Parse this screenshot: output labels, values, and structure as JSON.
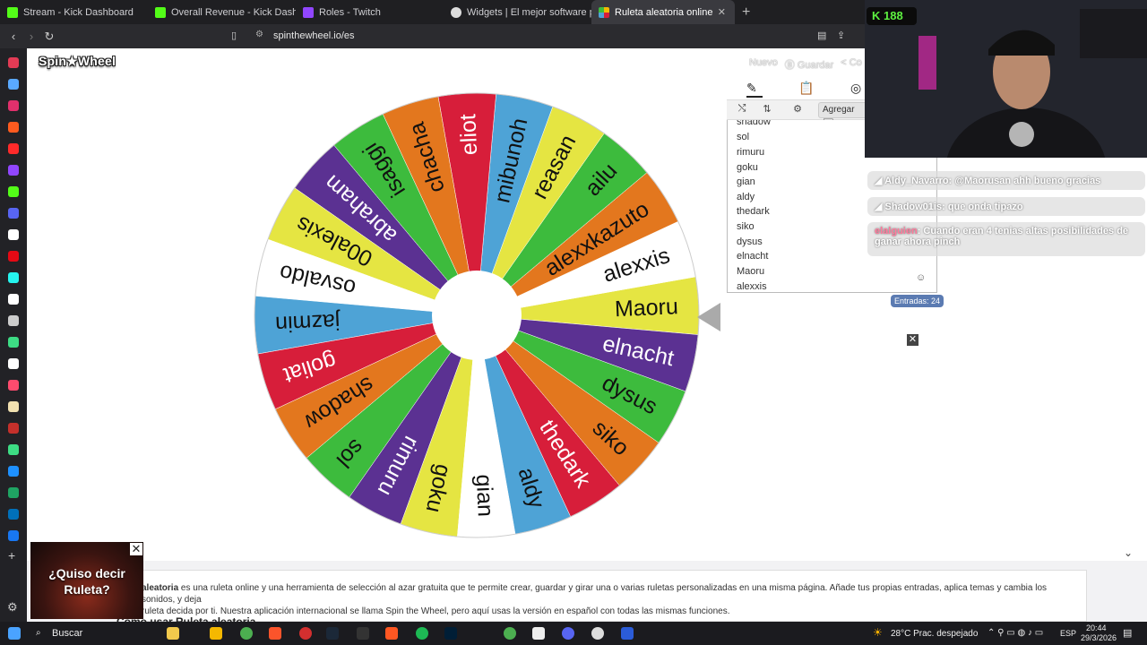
{
  "browser": {
    "tabs": [
      {
        "label": "Stream - Kick Dashboard",
        "color": "#53fc18"
      },
      {
        "label": "Overall Revenue - Kick Dashboard",
        "color": "#53fc18"
      },
      {
        "label": "Roles - Twitch",
        "color": "#9146ff"
      },
      {
        "label": "Widgets | El mejor software para pot",
        "color": "#dddddd"
      },
      {
        "label": "Ruleta aleatoria online – ruleta d",
        "color": "#f5b800"
      }
    ],
    "url": "spinthewheel.io/es"
  },
  "site": {
    "logo": "Spin★Wheel",
    "links": [
      "Nuevo",
      "Ⓑ Guardar",
      "< Co"
    ]
  },
  "wheel": {
    "names": [
      "Maoru",
      "alexxis",
      "alexxkazuto",
      "ailu",
      "reasan",
      "mibunoh",
      "eliot",
      "chacha",
      "isaggi",
      "abraham",
      "00alexis",
      "osvaldo",
      "jazmin",
      "goliat",
      "shadow",
      "sol",
      "rimuru",
      "goku",
      "gian",
      "aldy",
      "thedark",
      "siko",
      "dysus",
      "elnacht"
    ],
    "colors": [
      "#e5e542",
      "#ffffff",
      "#e3771e",
      "#3dbb3d",
      "#e5e542",
      "#4ea3d6",
      "#d71e3a",
      "#e3771e",
      "#3dbb3d",
      "#5b3192",
      "#e5e542",
      "#ffffff",
      "#4ea3d6",
      "#d71e3a",
      "#e3771e",
      "#3dbb3d",
      "#5b3192",
      "#e5e542",
      "#ffffff",
      "#4ea3d6",
      "#d71e3a",
      "#e3771e",
      "#3dbb3d",
      "#5b3192"
    ]
  },
  "panel": {
    "tabs": [
      "pencil-icon",
      "clipboard-icon",
      "eye-off-icon"
    ],
    "tools": [
      "shuffle-icon",
      "sort-icon",
      "settings-icon"
    ],
    "add_label": "Agregar 🖼",
    "entries": [
      "shadow",
      "sol",
      "rimuru",
      "goku",
      "gian",
      "aldy",
      "thedark",
      "siko",
      "dysus",
      "elnacht",
      "Maoru",
      "alexxis"
    ],
    "count": "Entradas: 24"
  },
  "stream": {
    "kick_count": "188",
    "chat": [
      {
        "user": "Aldy_Navarro",
        "text": ": @Maorusan ahh bueno gracias"
      },
      {
        "user": "Shadow01is",
        "text": ": que onda tipazo"
      },
      {
        "user": "elalguien",
        "text": ": Cuando eran 4 tenias altas posibilidades de ganar ahora pinch"
      }
    ]
  },
  "bottom": {
    "text_bold": "aleatoria",
    "text1": " es una ruleta online y una herramienta de selección al azar gratuita que te permite crear, guardar y girar una o varias ruletas personalizadas en una misma página. Añade tus propias entradas, aplica temas y cambia los sonidos, y deja",
    "text2": "ruleta decida por ti. Nuestra aplicación internacional se llama Spin the Wheel, pero aquí usas la versión en español con todas las mismas funciones.",
    "heading": "Cómo usar Ruleta aleatoria"
  },
  "ad": {
    "text": "¿Quiso decir Ruleta?"
  },
  "taskbar": {
    "search": "Buscar",
    "weather": "28°C  Prac. despejado",
    "lang": "ESP",
    "time": "20:44",
    "date": "29/3/2026"
  }
}
